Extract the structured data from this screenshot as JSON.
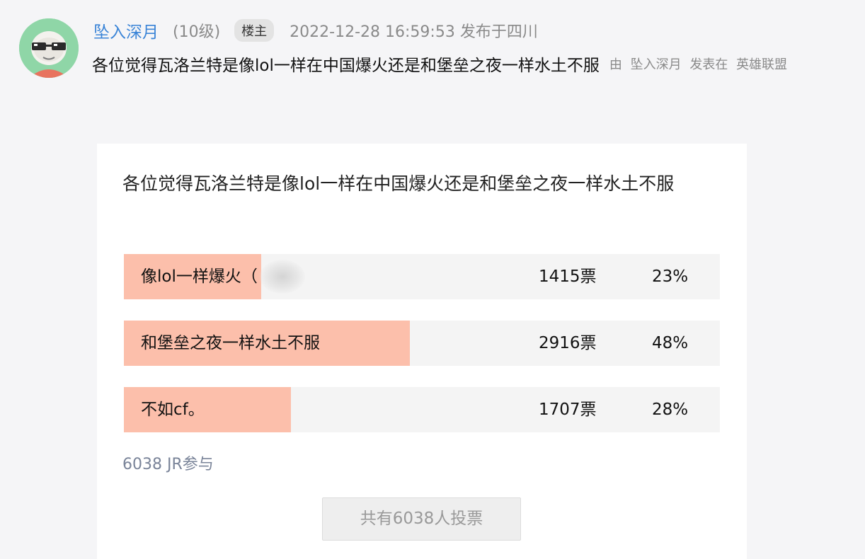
{
  "post": {
    "username": "坠入深月",
    "level": "(10级)",
    "badge": "楼主",
    "timestamp": "2022-12-28 16:59:53 发布于四川",
    "title": "各位觉得瓦洛兰特是像lol一样在中国爆火还是和堡垒之夜一样水土不服",
    "meta_by": "由",
    "meta_author": "坠入深月",
    "meta_posted": "发表在",
    "meta_forum": "英雄联盟"
  },
  "poll": {
    "question": "各位觉得瓦洛兰特是像lol一样在中国爆火还是和堡垒之夜一样水土不服",
    "options": [
      {
        "label": "像lol一样爆火（",
        "votes": "1415票",
        "percent": "23%",
        "share": 0.23
      },
      {
        "label": "和堡垒之夜一样水土不服",
        "votes": "2916票",
        "percent": "48%",
        "share": 0.48
      },
      {
        "label": "不如cf。",
        "votes": "1707票",
        "percent": "28%",
        "share": 0.28
      }
    ],
    "participants": "6038 JR参与",
    "button_label": "共有6038人投票"
  },
  "colors": {
    "accent_link": "#3a84d7",
    "bar_fill": "#fcbfab",
    "bar_track": "#f4f4f4",
    "avatar_bg": "#8fd6a7"
  }
}
